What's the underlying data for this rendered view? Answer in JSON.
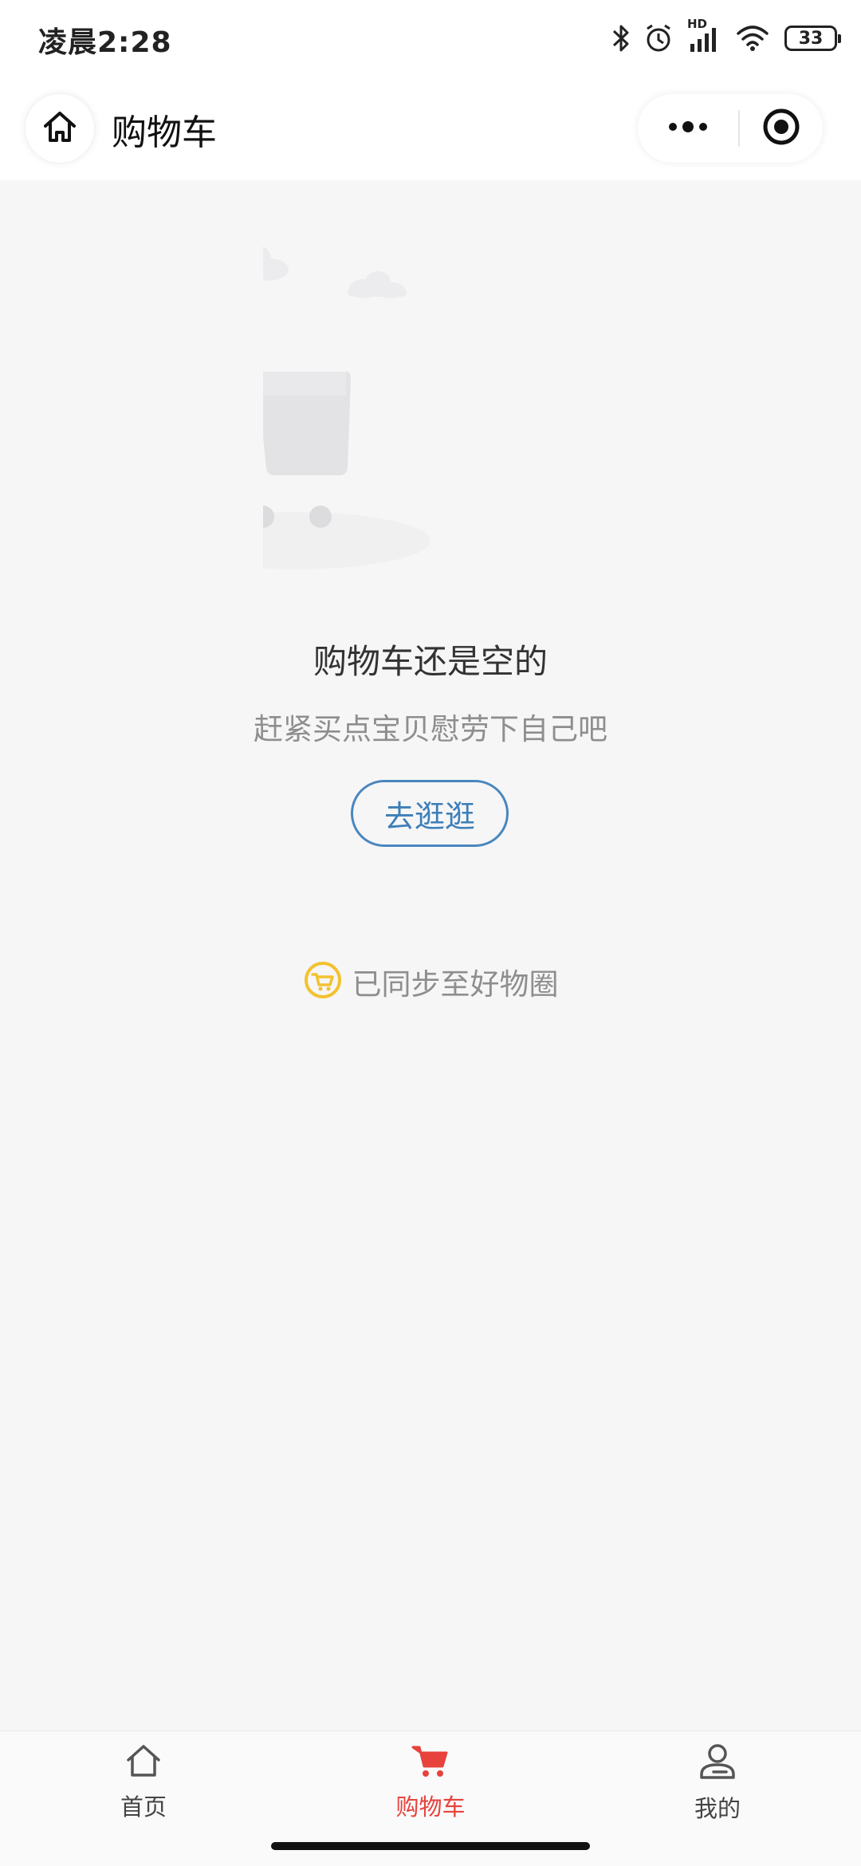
{
  "status_bar": {
    "time": "凌晨2:28",
    "network_label": "HD",
    "battery_level": "33",
    "icons": [
      "bluetooth-icon",
      "alarm-icon",
      "signal-icon",
      "wifi-icon",
      "battery-icon"
    ]
  },
  "nav": {
    "title": "购物车",
    "home_icon": "home-icon",
    "more_icon": "more-dots-icon",
    "close_icon": "target-close-icon"
  },
  "empty_state": {
    "title": "购物车还是空的",
    "subtitle": "赶紧买点宝贝慰劳下自己吧",
    "button_label": "去逛逛",
    "illustration": "empty-cart-illustration"
  },
  "sync": {
    "text": "已同步至好物圈",
    "icon": "haowuquan-icon"
  },
  "tabs": [
    {
      "label": "首页",
      "icon": "home-tab-icon",
      "active": false
    },
    {
      "label": "购物车",
      "icon": "cart-tab-icon",
      "active": true
    },
    {
      "label": "我的",
      "icon": "user-tab-icon",
      "active": false
    }
  ],
  "colors": {
    "accent_red": "#e8423c",
    "button_blue": "#3d7fb8",
    "sync_yellow": "#f2c230",
    "background": "#f6f6f7"
  }
}
